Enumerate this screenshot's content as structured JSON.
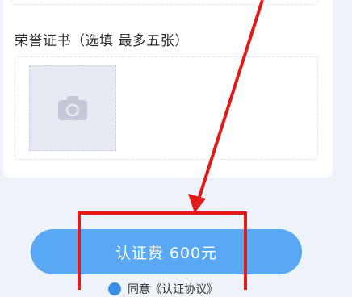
{
  "form": {
    "honor_certificate_label": "荣誉证书（选填 最多五张）"
  },
  "upload": {
    "add_photo_icon": "camera-icon"
  },
  "submit": {
    "label": "认证费 600元"
  },
  "agreement": {
    "text": "同意《认证协议》"
  },
  "colors": {
    "accent": "#58a8f4",
    "annotation": "#e01b1b"
  }
}
